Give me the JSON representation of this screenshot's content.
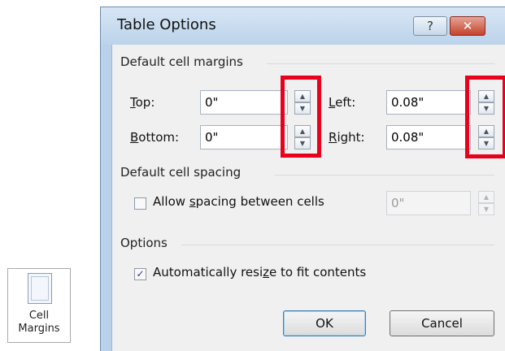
{
  "ribbon": {
    "button_label": "Cell\nMargins",
    "icon": "cell-margins-icon"
  },
  "dialog": {
    "title": "Table Options",
    "help_glyph": "?",
    "close_glyph": "✕"
  },
  "margins": {
    "heading": "Default cell margins",
    "top": {
      "label_acc": "T",
      "label_rest": "op:",
      "value": "0\""
    },
    "bottom": {
      "label_acc": "B",
      "label_rest": "ottom:",
      "value": "0\""
    },
    "left": {
      "label_acc": "L",
      "label_rest": "eft:",
      "value": "0.08\""
    },
    "right": {
      "label_acc": "R",
      "label_rest": "ight:",
      "value": "0.08\""
    }
  },
  "spacing": {
    "heading": "Default cell spacing",
    "checkbox_pre": "Allow ",
    "checkbox_acc": "s",
    "checkbox_post": "pacing between cells",
    "checked": false,
    "value": "0\""
  },
  "options": {
    "heading": "Options",
    "checkbox_pre": "Automatically resi",
    "checkbox_acc": "z",
    "checkbox_post": "e to fit contents",
    "checked": true,
    "check_glyph": "✓"
  },
  "buttons": {
    "ok": "OK",
    "cancel": "Cancel"
  },
  "highlight_color": "#e8001c"
}
